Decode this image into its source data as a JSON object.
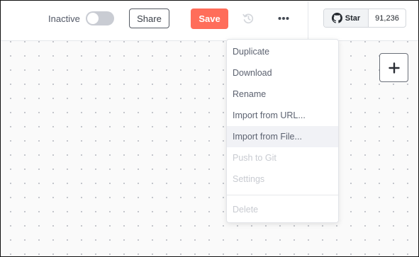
{
  "header": {
    "active_toggle": {
      "label": "Inactive",
      "on": false
    },
    "share_label": "Share",
    "save_label": "Save",
    "history_icon": "history-icon",
    "more_icon": "more-horizontal-icon",
    "github": {
      "star_label": "Star",
      "star_count": "91,236",
      "icon": "github-icon"
    }
  },
  "canvas": {
    "add_node_icon": "plus-icon"
  },
  "workflow_menu": {
    "items": [
      {
        "label": "Duplicate",
        "enabled": true
      },
      {
        "label": "Download",
        "enabled": true
      },
      {
        "label": "Rename",
        "enabled": true
      },
      {
        "label": "Import from URL...",
        "enabled": true
      },
      {
        "label": "Import from File...",
        "enabled": true,
        "hovered": true
      },
      {
        "label": "Push to Git",
        "enabled": false
      },
      {
        "label": "Settings",
        "enabled": false
      },
      {
        "label": "Delete",
        "enabled": false
      }
    ]
  },
  "colors": {
    "save_button": "#ff6d5a",
    "menu_text": "#5c6270",
    "menu_disabled_text": "#c8cbd1",
    "menu_hover_bg": "#f1f2f6"
  }
}
